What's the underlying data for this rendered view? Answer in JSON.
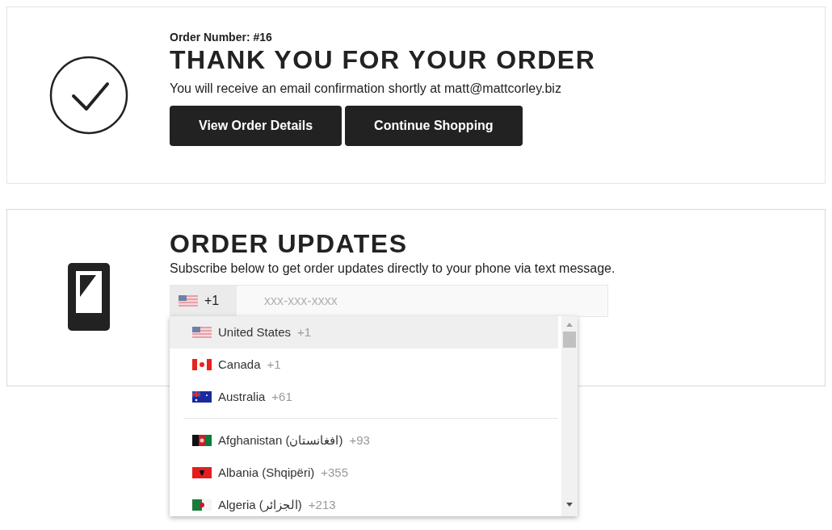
{
  "confirmation": {
    "order_number": "Order Number: #16",
    "title": "THANK YOU FOR YOUR ORDER",
    "message": "You will receive an email confirmation shortly at matt@mattcorley.biz",
    "buttons": [
      "View Order Details",
      "Continue Shopping"
    ]
  },
  "updates": {
    "title": "ORDER UPDATES",
    "description": "Subscribe below to get order updates directly to your phone via text message.",
    "phone": {
      "kind": "us",
      "dial_code": "+1",
      "placeholder": "xxx-xxx-xxxx"
    },
    "dropdown": {
      "expanded": true,
      "preferred": [
        {
          "kind": "us",
          "name": "United States",
          "dial_code": "+1",
          "selected": true
        },
        {
          "kind": "ca",
          "name": "Canada",
          "dial_code": "+1",
          "selected": false
        },
        {
          "kind": "au",
          "name": "Australia",
          "dial_code": "+61",
          "selected": false
        }
      ],
      "countries": [
        {
          "kind": "af",
          "name": "Afghanistan (افغانستان)",
          "dial_code": "+93",
          "selected": false
        },
        {
          "kind": "al",
          "name": "Albania (Shqipëri)",
          "dial_code": "+355",
          "selected": false
        },
        {
          "kind": "dz",
          "name": "Algeria (الجزائر)",
          "dial_code": "+213",
          "selected": false
        }
      ]
    }
  }
}
